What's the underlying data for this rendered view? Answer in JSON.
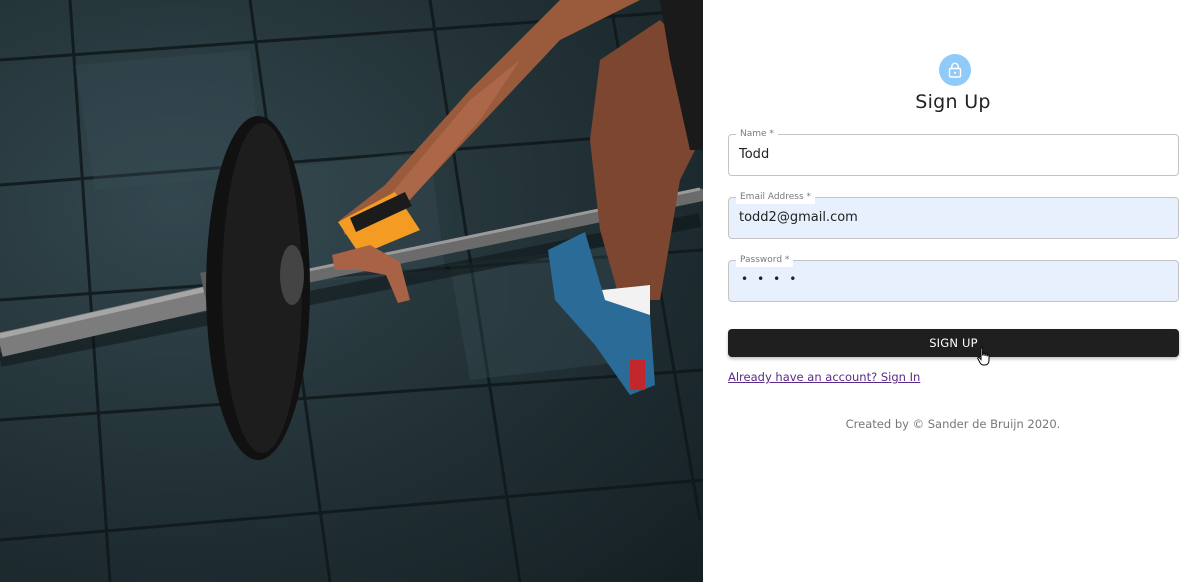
{
  "form": {
    "title": "Sign Up",
    "fields": {
      "name": {
        "label": "Name *",
        "value": "Todd"
      },
      "email": {
        "label": "Email Address *",
        "value": "todd2@gmail.com"
      },
      "password": {
        "label": "Password *",
        "value_masked": "••••"
      }
    },
    "submit_label": "SIGN UP",
    "signin_link": "Already have an account? Sign In"
  },
  "footer": {
    "text": "Created by © Sander de Bruijn 2020."
  },
  "colors": {
    "avatar_bg": "#90caf9",
    "button_bg": "#1f1f1f",
    "autofill_bg": "#e8f0fe",
    "link": "#5b2b89"
  },
  "icons": {
    "avatar": "lock-icon",
    "cursor": "hand-pointer-icon"
  }
}
